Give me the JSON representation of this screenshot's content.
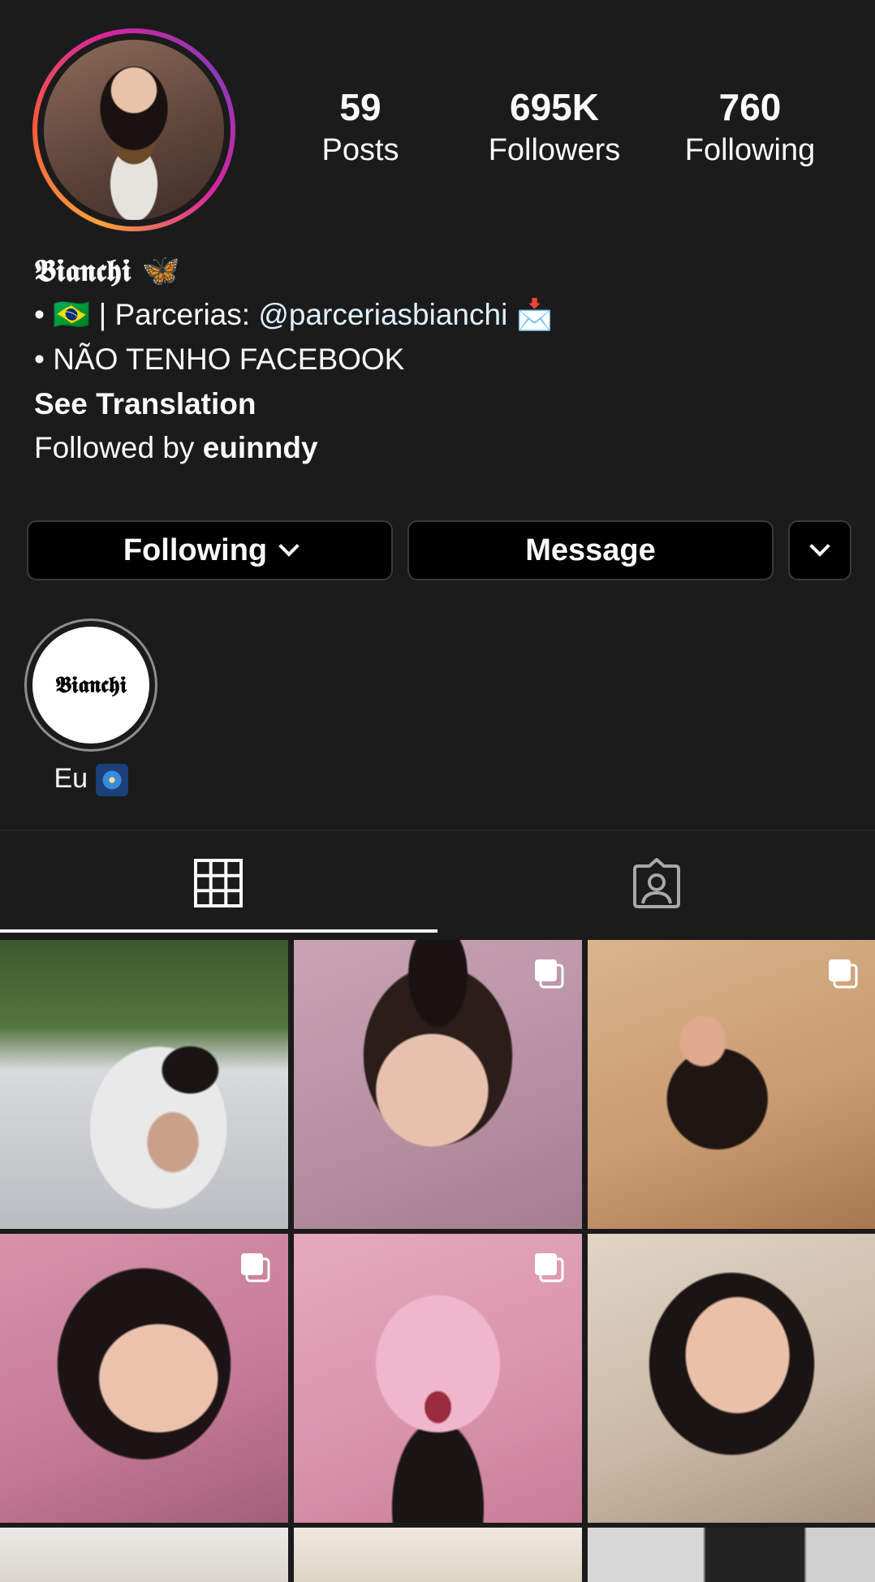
{
  "profile": {
    "stats": [
      {
        "value": "59",
        "label": "Posts"
      },
      {
        "value": "695K",
        "label": "Followers"
      },
      {
        "value": "760",
        "label": "Following"
      }
    ],
    "name": "𝕭𝖎𝖆𝖓𝖈𝖍𝖎 🦋",
    "bio_line1_prefix": "• 🇧🇷 | Parcerias: ",
    "bio_line1_handle": "@parceriasbianchi",
    "bio_line1_suffix": " 📩",
    "bio_line2": "• NÃO TENHO FACEBOOK",
    "see_translation": "See Translation",
    "followed_by_prefix": "Followed by ",
    "followed_by_user": "euinndy"
  },
  "actions": {
    "following_label": "Following",
    "message_label": "Message"
  },
  "highlight": {
    "cover_text": "𝕭𝖎𝖆𝖓𝖈𝖍𝖎",
    "label": "Eu"
  },
  "tabs": [
    {
      "icon": "grid-icon",
      "active": true
    },
    {
      "icon": "tagged-icon",
      "active": false
    }
  ],
  "posts": [
    {
      "multi": false
    },
    {
      "multi": true
    },
    {
      "multi": true
    },
    {
      "multi": true
    },
    {
      "multi": true
    },
    {
      "multi": false
    },
    {
      "multi": false
    },
    {
      "multi": false
    },
    {
      "multi": false
    }
  ],
  "colors": {
    "background": "#1b1b1c",
    "text": "#fafafa",
    "link": "#e0f1ff",
    "button_bg": "#000000",
    "ring_gradient": [
      "#f9a23a",
      "#f55b3b",
      "#d6249f",
      "#8a3ab9"
    ]
  }
}
